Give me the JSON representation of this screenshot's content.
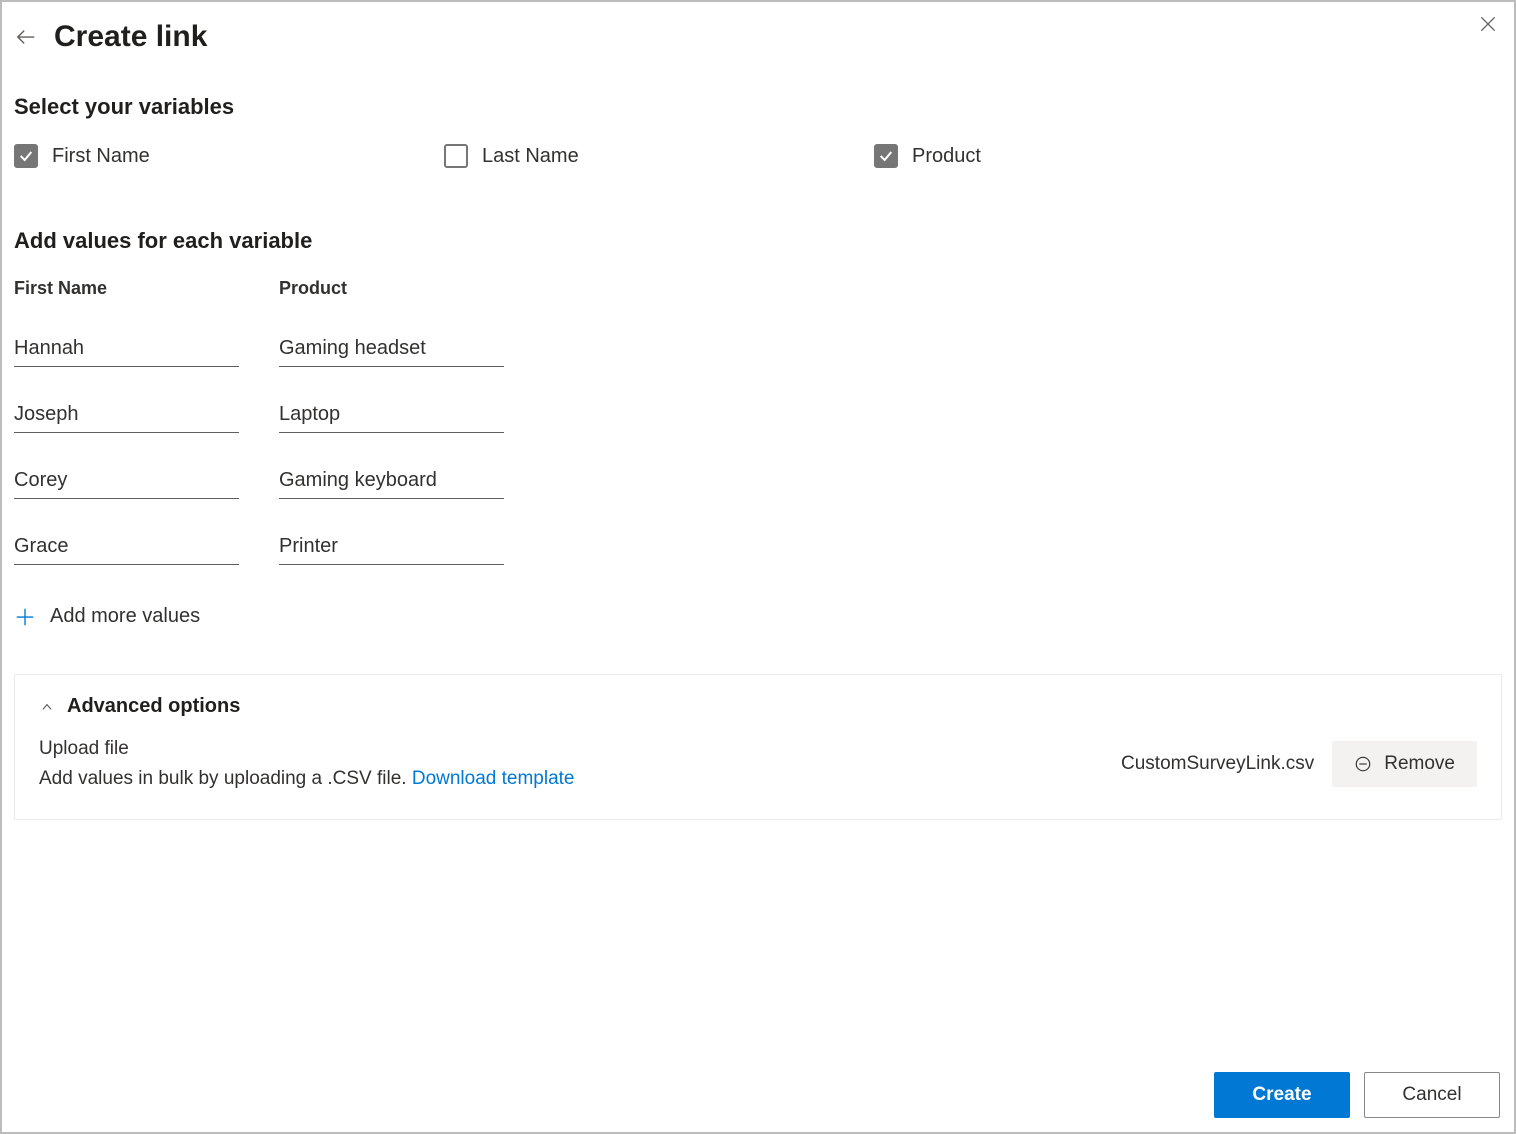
{
  "header": {
    "title": "Create link"
  },
  "variables": {
    "heading": "Select your variables",
    "items": [
      {
        "label": "First Name",
        "checked": true
      },
      {
        "label": "Last Name",
        "checked": false
      },
      {
        "label": "Product",
        "checked": true
      }
    ]
  },
  "values": {
    "heading": "Add values for each variable",
    "columns": [
      "First Name",
      "Product"
    ],
    "rows": [
      {
        "first_name": "Hannah",
        "product": "Gaming headset"
      },
      {
        "first_name": "Joseph",
        "product": "Laptop"
      },
      {
        "first_name": "Corey",
        "product": "Gaming keyboard"
      },
      {
        "first_name": "Grace",
        "product": "Printer"
      }
    ],
    "add_more_label": "Add more values"
  },
  "advanced": {
    "title": "Advanced options",
    "upload_label": "Upload file",
    "description": "Add values in bulk by uploading a .CSV file. ",
    "download_link": "Download template",
    "filename": "CustomSurveyLink.csv",
    "remove_label": "Remove"
  },
  "footer": {
    "create_label": "Create",
    "cancel_label": "Cancel"
  }
}
